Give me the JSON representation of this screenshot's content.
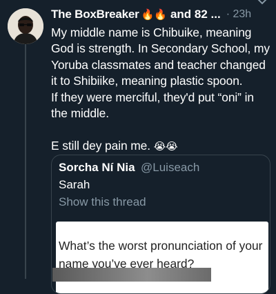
{
  "tweet": {
    "author_name": "The BoxBreaker",
    "author_emojis": "🔥🔥",
    "author_rest": "and 82 ...",
    "time": "· 23h",
    "body": "My middle name is Chibuike, meaning God is strength. In Secondary School, my Yoruba classmates and teacher changed it to Shibiike, meaning plastic spoon.\nIf they were merciful, they'd put “oni” in the middle.\n\nE still dey pain me.",
    "body_emojis": "😭😭"
  },
  "quote": {
    "author_name": "Sorcha Ní Nia",
    "handle": "@Luiseach",
    "text": "Sarah",
    "show_thread": "Show this thread",
    "inner_text": "What’s the worst pronunciation of your name you’ve ever heard?"
  },
  "colors": {
    "background": "#15202b",
    "secondary_text": "#8899a6",
    "border": "#38444d"
  }
}
